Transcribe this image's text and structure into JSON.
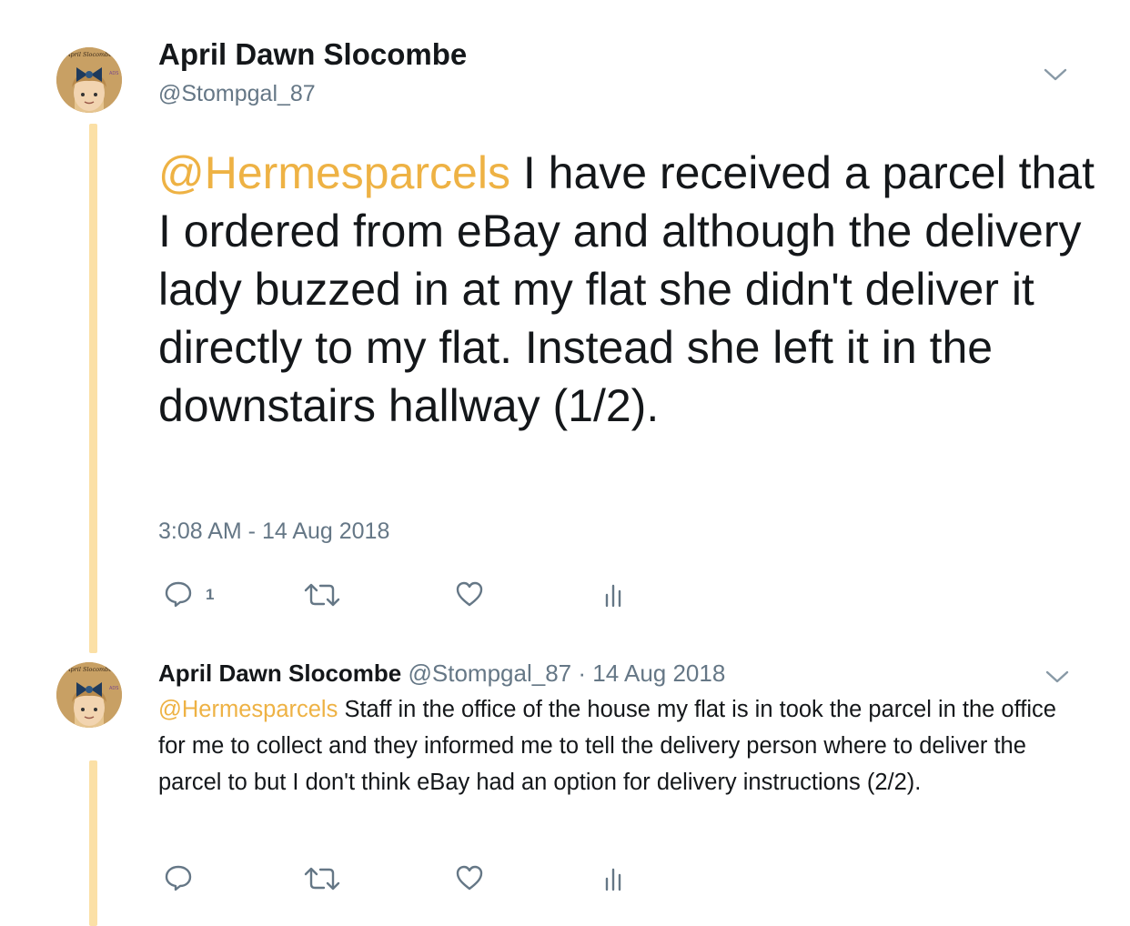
{
  "thread": {
    "main_tweet": {
      "author_name": "April Dawn Slocombe",
      "handle": "@Stompgal_87",
      "avatar_text": "April Slocombe",
      "mention": "@Hermesparcels",
      "body": " I have received a parcel that I ordered from eBay and although the delivery lady buzzed in at my flat she didn't deliver it directly to my flat. Instead she left it in the downstairs hallway (1/2).",
      "timestamp": "3:08 AM - 14 Aug 2018",
      "actions": {
        "reply_icon": "reply-icon",
        "reply_count": "1",
        "retweet_icon": "retweet-icon",
        "like_icon": "heart-icon",
        "analytics_icon": "analytics-icon"
      }
    },
    "reply_tweet": {
      "author_name": "April Dawn Slocombe",
      "handle": "@Stompgal_87",
      "separator": "·",
      "date": "14 Aug 2018",
      "avatar_text": "April Slocombe",
      "mention": "@Hermesparcels",
      "body": " Staff in the office of the house my flat is in took the parcel in the office for me to collect and they informed me to tell the delivery person where to deliver the parcel to but I don't think eBay had an option for delivery instructions (2/2).",
      "actions": {
        "reply_icon": "reply-icon",
        "retweet_icon": "retweet-icon",
        "like_icon": "heart-icon",
        "analytics_icon": "analytics-icon"
      }
    }
  },
  "colors": {
    "mention": "#eeb244",
    "thread_line": "#fbe0a6",
    "secondary_text": "#657786",
    "primary_text": "#14171a"
  }
}
